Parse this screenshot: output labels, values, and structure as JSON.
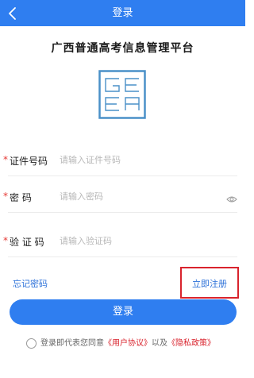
{
  "header": {
    "title": "登录"
  },
  "platform": {
    "name": "广西普通高考信息管理平台"
  },
  "logo": {
    "letters": [
      "G",
      "E",
      "E",
      "A"
    ],
    "color": "#4a90c8"
  },
  "form": {
    "required_mark": "*",
    "id_number": {
      "label": "证件号码",
      "placeholder": "请输入证件号码"
    },
    "password": {
      "label": "密 码",
      "placeholder": "请输入密码"
    },
    "captcha": {
      "label": "验 证 码",
      "placeholder": "请输入验证码"
    }
  },
  "links": {
    "forgot_password": "忘记密码",
    "register": "立即注册"
  },
  "login_button": {
    "label": "登录"
  },
  "agreement": {
    "prefix": "登录即代表您同意",
    "user_agreement": "《用户协议》",
    "and": "以及",
    "privacy_policy": "《隐私政策》"
  },
  "colors": {
    "primary": "#2f7ef0",
    "link": "#2a6fd8",
    "required": "#e53935",
    "highlight": "#d9232d"
  }
}
